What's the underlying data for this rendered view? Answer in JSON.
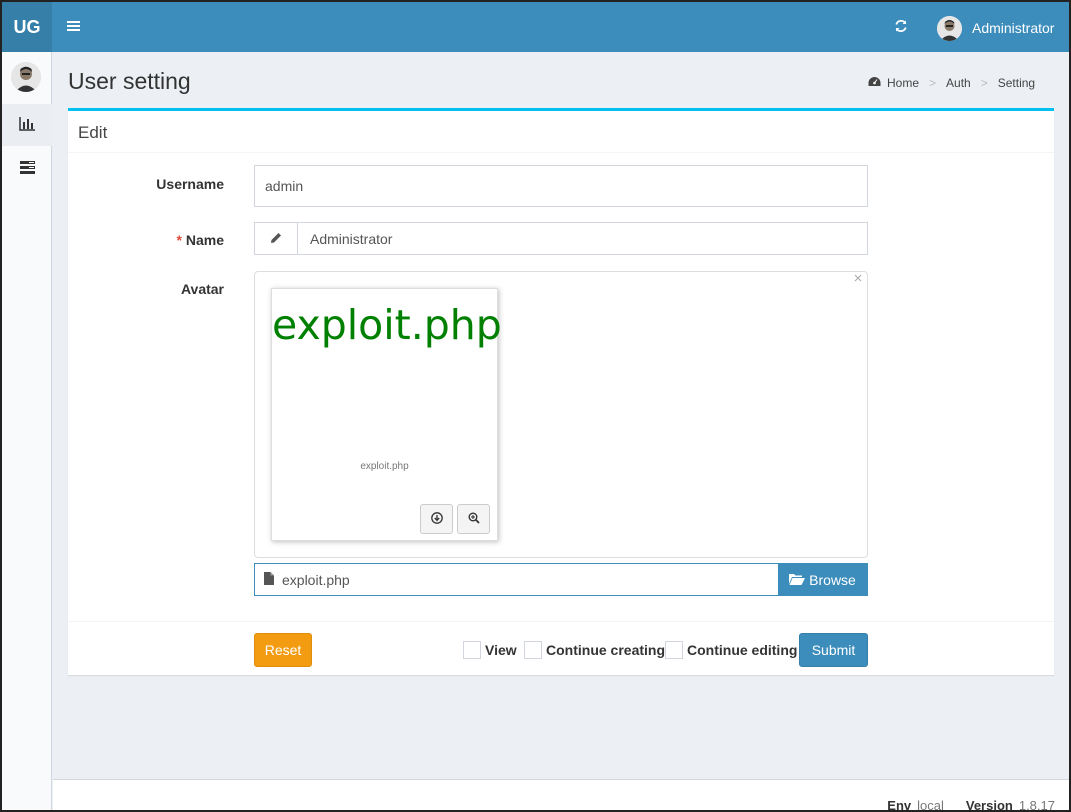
{
  "header": {
    "logo": "UG",
    "user_name": "Administrator"
  },
  "page": {
    "title": "User setting",
    "breadcrumb": [
      "Home",
      "Auth",
      "Setting"
    ]
  },
  "form": {
    "box_title": "Edit",
    "username_label": "Username",
    "username_value": "admin",
    "name_required_mark": "*",
    "name_label": "Name",
    "name_value": "Administrator",
    "avatar_label": "Avatar",
    "preview_big_text": "exploit.php",
    "preview_caption": "exploit.php",
    "file_name": "exploit.php",
    "browse_label": "Browse",
    "reset_label": "Reset",
    "checks": [
      "View",
      "Continue creating",
      "Continue editing"
    ],
    "submit_label": "Submit"
  },
  "footer": {
    "env_label": "Env",
    "env_value": "local",
    "version_label": "Version",
    "version_value": "1.8.17"
  },
  "colors": {
    "header": "#3c8dbc",
    "logo_bg": "#367fa9",
    "box_top": "#00c0ef",
    "reset_btn": "#f39c12",
    "submit_btn": "#3c8dbc",
    "preview_text": "#008000"
  },
  "icons": {
    "menu": "bars-icon",
    "refresh": "refresh-icon",
    "name_addon": "pencil-icon",
    "file": "file-icon",
    "browse": "folder-open-icon",
    "download": "download-icon",
    "zoom": "zoom-in-icon",
    "close": "close-icon",
    "home": "dashboard-icon",
    "sidebar_chart": "bar-chart-icon",
    "sidebar_list": "list-icon"
  }
}
